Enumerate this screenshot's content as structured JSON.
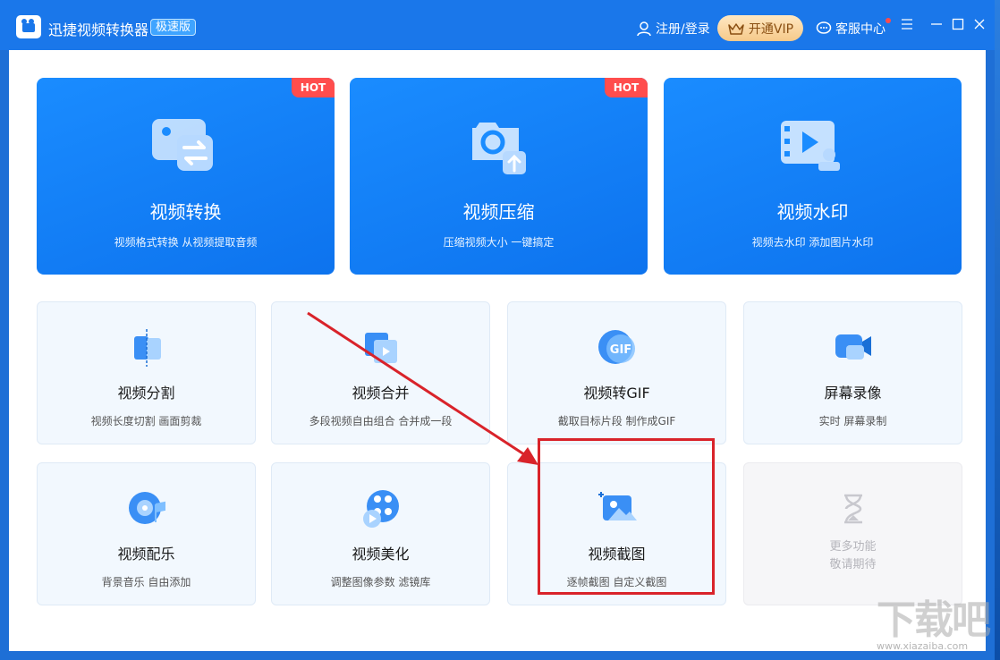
{
  "titlebar": {
    "app_title": "迅捷视频转换器",
    "badge": "极速版",
    "login_label": "注册/登录",
    "vip_label": "开通VIP",
    "service_label": "客服中心"
  },
  "big_cards": [
    {
      "title": "视频转换",
      "subtitle": "视频格式转换 从视频提取音频",
      "badge": "HOT"
    },
    {
      "title": "视频压缩",
      "subtitle": "压缩视频大小 一键搞定",
      "badge": "HOT"
    },
    {
      "title": "视频水印",
      "subtitle": "视频去水印 添加图片水印"
    }
  ],
  "small_cards": [
    {
      "title": "视频分割",
      "subtitle": "视频长度切割 画面剪裁"
    },
    {
      "title": "视频合并",
      "subtitle": "多段视频自由组合 合并成一段"
    },
    {
      "title": "视频转GIF",
      "subtitle": "截取目标片段 制作成GIF",
      "icon_text": "GIF"
    },
    {
      "title": "屏幕录像",
      "subtitle": "实时 屏幕录制"
    },
    {
      "title": "视频配乐",
      "subtitle": "背景音乐 自由添加"
    },
    {
      "title": "视频美化",
      "subtitle": "调整图像参数 滤镜库"
    },
    {
      "title": "视频截图",
      "subtitle": "逐帧截图 自定义截图"
    },
    {
      "title_line1": "更多功能",
      "title_line2": "敬请期待"
    }
  ],
  "watermark": {
    "text": "下载吧",
    "url": "www.xiazaiba.com"
  },
  "colors": {
    "accent": "#1a77ea",
    "hot": "#ff4d4d",
    "annotation": "#d9232a"
  }
}
